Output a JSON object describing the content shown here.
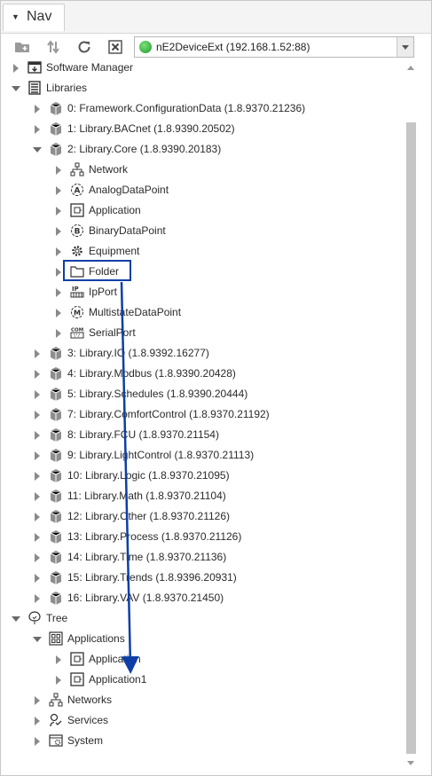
{
  "tab": {
    "label": "Nav"
  },
  "toolbar": {
    "station": "nE2DeviceExt (192.168.1.52:88)"
  },
  "tree": {
    "software_manager": "Software Manager",
    "libraries": "Libraries",
    "lib0": "0: Framework.ConfigurationData (1.8.9370.21236)",
    "lib1": "1: Library.BACnet (1.8.9390.20502)",
    "lib2": "2: Library.Core (1.8.9390.20183)",
    "core_items": [
      "Network",
      "AnalogDataPoint",
      "Application",
      "BinaryDataPoint",
      "Equipment",
      "Folder",
      "IpPort",
      "MultistateDataPoint",
      "SerialPort"
    ],
    "libs_rest": [
      "3: Library.IO (1.8.9392.16277)",
      "4: Library.Modbus (1.8.9390.20428)",
      "5: Library.Schedules (1.8.9390.20444)",
      "7: Library.ComfortControl (1.8.9370.21192)",
      "8: Library.FCU (1.8.9370.21154)",
      "9: Library.LightControl (1.8.9370.21113)",
      "10: Library.Logic (1.8.9370.21095)",
      "11: Library.Math (1.8.9370.21104)",
      "12: Library.Other (1.8.9370.21126)",
      "13: Library.Process (1.8.9370.21126)",
      "14: Library.Time (1.8.9370.21136)",
      "15: Library.Trends (1.8.9396.20931)",
      "16: Library.VAV (1.8.9370.21450)"
    ],
    "tree": "Tree",
    "applications": "Applications",
    "app_items": [
      "Application",
      "Application1"
    ],
    "networks": "Networks",
    "services": "Services",
    "system": "System"
  },
  "colors": {
    "highlight": "#0d3fa6",
    "arrow": "#0d3fa6",
    "status_ok": "#2aa33a"
  }
}
